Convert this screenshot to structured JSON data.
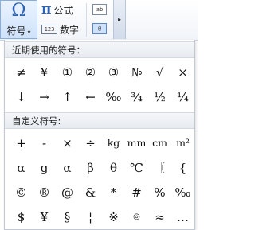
{
  "ribbon": {
    "symbol_button": {
      "glyph": "Ω",
      "label": "符号",
      "caret": "▾"
    },
    "formula_button": {
      "glyph": "π",
      "label": "公式"
    },
    "number_button": {
      "glyph": "123",
      "label": "数字"
    },
    "mini_icon_1": "ab",
    "mini_icon_2": "@",
    "more_arrow": "▸"
  },
  "dropdown": {
    "recent_header": "近期使用的符号：",
    "recent_symbols": [
      "≠",
      "¥",
      "①",
      "②",
      "③",
      "№",
      "√",
      "×",
      "↓",
      "→",
      "↑",
      "←",
      "‰",
      "¾",
      "½",
      "¼"
    ],
    "custom_header": "自定义符号:",
    "custom_symbols": [
      "+",
      "-",
      "×",
      "÷",
      "kg",
      "mm",
      "cm",
      "m²",
      "α",
      "g",
      "α",
      "β",
      "θ",
      "℃",
      "〖",
      "{",
      "©",
      "®",
      "@",
      "&",
      "*",
      "#",
      "%",
      "‰",
      "$",
      "¥",
      "§",
      "¦",
      "※",
      "◎",
      "≈",
      "…"
    ]
  }
}
